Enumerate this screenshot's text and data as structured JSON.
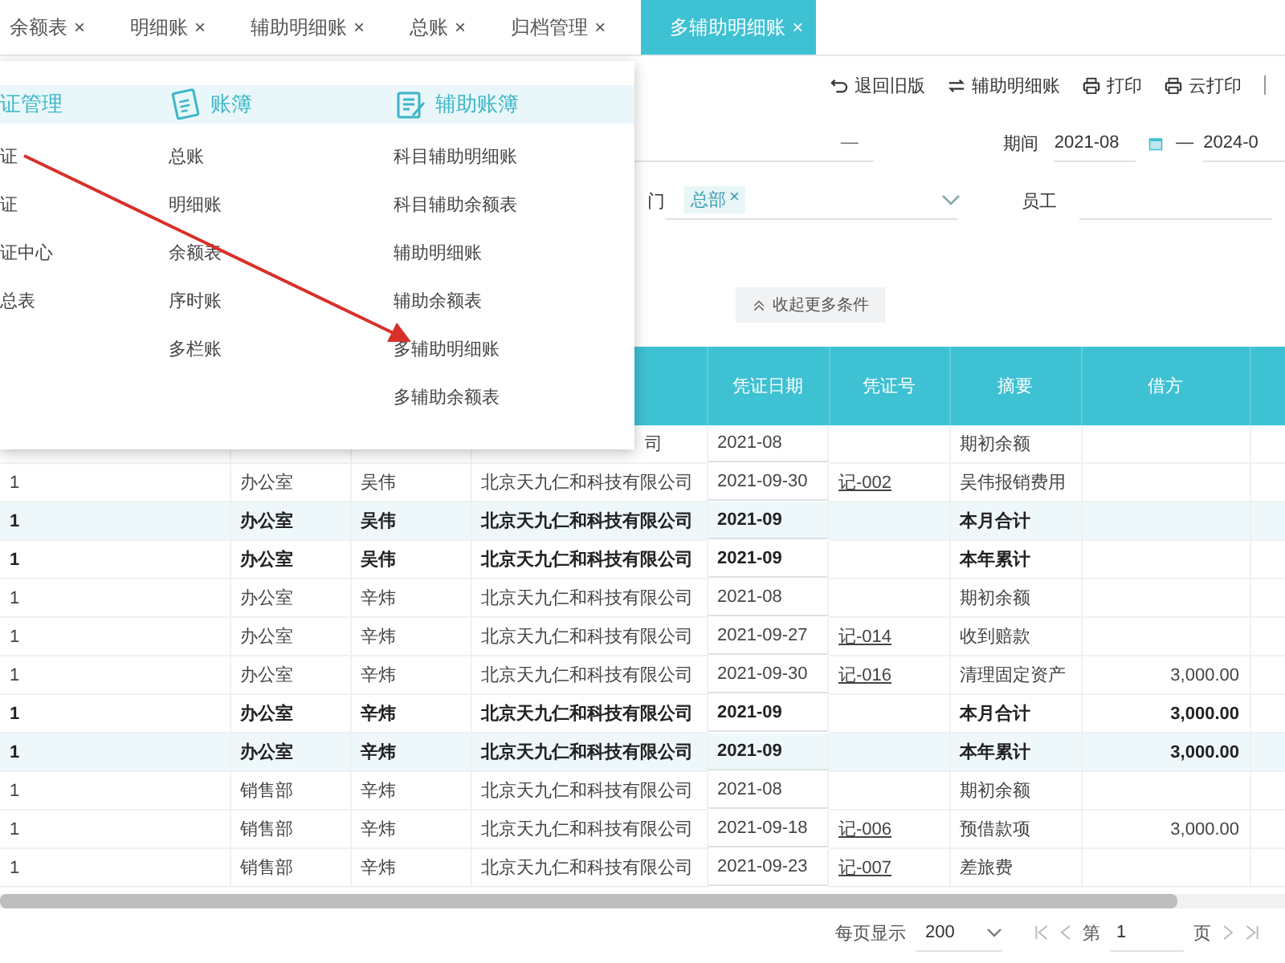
{
  "tabs": [
    {
      "label": "余额表",
      "selected": false
    },
    {
      "label": "明细账",
      "selected": false
    },
    {
      "label": "辅助明细账",
      "selected": false
    },
    {
      "label": "总账",
      "selected": false
    },
    {
      "label": "归档管理",
      "selected": false
    },
    {
      "label": "多辅助明细账",
      "selected": true
    }
  ],
  "tab_close": "×",
  "toolbar": [
    {
      "kind": "undo",
      "label": "退回旧版"
    },
    {
      "kind": "switch",
      "label": "辅助明细账"
    },
    {
      "kind": "print",
      "label": "打印"
    },
    {
      "kind": "print",
      "label": "云打印"
    }
  ],
  "filters": {
    "range_dash": "—",
    "period_label": "期间",
    "period_from": "2021-08",
    "period_dash": "—",
    "period_to": "2024-0",
    "department_label": "门",
    "department_tag": "总部",
    "tag_close": "×",
    "employee_label": "员工"
  },
  "collapse_button": "收起更多条件",
  "table": {
    "columns": [
      "凭证日期",
      "凭证号",
      "摘要",
      "借方"
    ],
    "rows": [
      {
        "kind": "partial",
        "highlighted": false,
        "company": "司",
        "date": "2021-08",
        "summary": "期初余额"
      },
      {
        "kind": "detail",
        "highlighted": false,
        "code": "1",
        "department": "办公室",
        "employee": "吴伟",
        "company": "北京天九仁和科技有限公司",
        "date": "2021-09-30",
        "voucher": "记-002",
        "summary": "吴伟报销费用"
      },
      {
        "kind": "total",
        "highlighted": true,
        "code": "1",
        "department": "办公室",
        "employee": "吴伟",
        "company": "北京天九仁和科技有限公司",
        "date": "2021-09",
        "summary": "本月合计"
      },
      {
        "kind": "total",
        "highlighted": false,
        "code": "1",
        "department": "办公室",
        "employee": "吴伟",
        "company": "北京天九仁和科技有限公司",
        "date": "2021-09",
        "summary": "本年累计"
      },
      {
        "kind": "detail",
        "highlighted": false,
        "code": "1",
        "department": "办公室",
        "employee": "辛炜",
        "company": "北京天九仁和科技有限公司",
        "date": "2021-08",
        "summary": "期初余额"
      },
      {
        "kind": "detail",
        "highlighted": false,
        "code": "1",
        "department": "办公室",
        "employee": "辛炜",
        "company": "北京天九仁和科技有限公司",
        "date": "2021-09-27",
        "voucher": "记-014",
        "summary": "收到赔款"
      },
      {
        "kind": "detail",
        "highlighted": false,
        "code": "1",
        "department": "办公室",
        "employee": "辛炜",
        "company": "北京天九仁和科技有限公司",
        "date": "2021-09-30",
        "voucher": "记-016",
        "summary": "清理固定资产",
        "debit": "3,000.00"
      },
      {
        "kind": "total",
        "highlighted": false,
        "code": "1",
        "department": "办公室",
        "employee": "辛炜",
        "company": "北京天九仁和科技有限公司",
        "date": "2021-09",
        "summary": "本月合计",
        "debit": "3,000.00"
      },
      {
        "kind": "total",
        "highlighted": true,
        "code": "1",
        "department": "办公室",
        "employee": "辛炜",
        "company": "北京天九仁和科技有限公司",
        "date": "2021-09",
        "summary": "本年累计",
        "debit": "3,000.00"
      },
      {
        "kind": "detail",
        "highlighted": false,
        "code": "1",
        "department": "销售部",
        "employee": "辛炜",
        "company": "北京天九仁和科技有限公司",
        "date": "2021-08",
        "summary": "期初余额"
      },
      {
        "kind": "detail",
        "highlighted": false,
        "code": "1",
        "department": "销售部",
        "employee": "辛炜",
        "company": "北京天九仁和科技有限公司",
        "date": "2021-09-18",
        "voucher": "记-006",
        "summary": "预借款项",
        "debit": "3,000.00"
      },
      {
        "kind": "detail",
        "highlighted": false,
        "code": "1",
        "department": "销售部",
        "employee": "辛炜",
        "company": "北京天九仁和科技有限公司",
        "date": "2021-09-23",
        "voucher": "记-007",
        "summary": "差旅费"
      }
    ]
  },
  "pagination": {
    "page_size_label": "每页显示",
    "page_size": "200",
    "page_prefix": "第",
    "page": "1",
    "page_suffix": "页"
  },
  "menu": {
    "columns": [
      {
        "kind": "none",
        "title": "证管理",
        "items": [
          "证",
          "证",
          "证中心",
          "总表"
        ]
      },
      {
        "kind": "book",
        "title": "账簿",
        "items": [
          "总账",
          "明细账",
          "余额表",
          "序时账",
          "多栏账"
        ]
      },
      {
        "kind": "ledger",
        "title": "辅助账簿",
        "items": [
          "科目辅助明细账",
          "科目辅助余额表",
          "辅助明细账",
          "辅助余额表",
          "多辅助明细账",
          "多辅助余额表"
        ]
      }
    ]
  },
  "annotation": {
    "kind": "arrow"
  }
}
